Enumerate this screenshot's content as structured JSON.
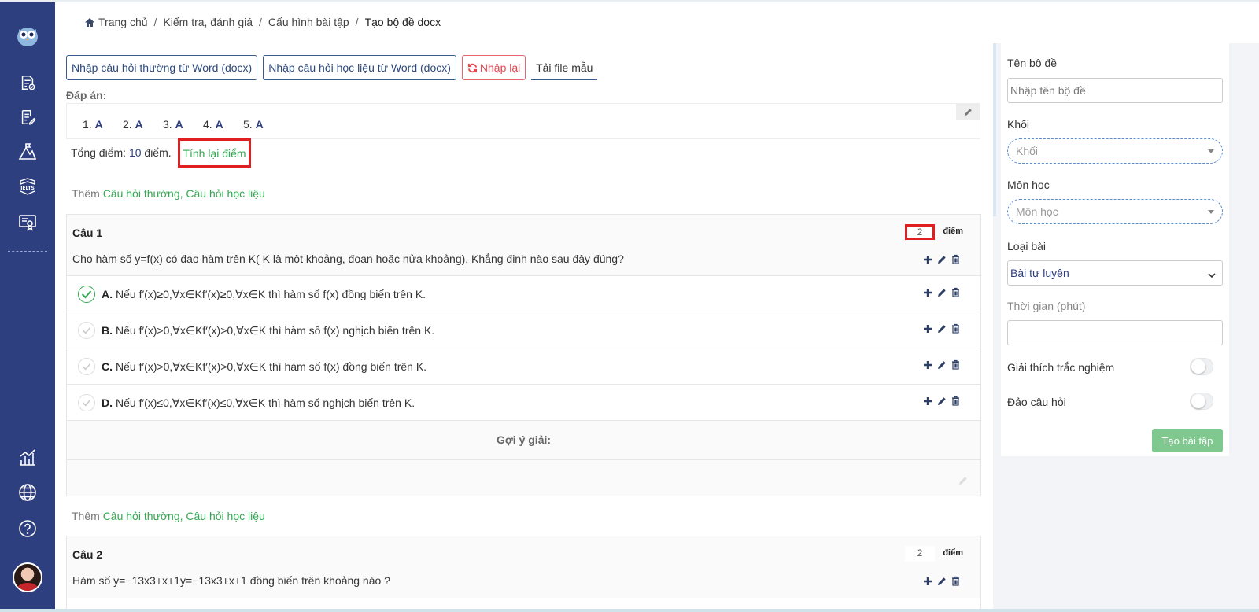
{
  "breadcrumb": {
    "home": "Trang chủ",
    "sep": "/",
    "level1": "Kiểm tra, đánh giá",
    "level2": "Cấu hình bài tập",
    "current": "Tạo bộ đề docx"
  },
  "toolbar": {
    "import_normal": "Nhập câu hỏi thường từ Word (docx)",
    "import_material": "Nhập câu hỏi học liệu từ Word (docx)",
    "reimport": "Nhập lại",
    "download_template": "Tải file mẫu"
  },
  "answers": {
    "label": "Đáp án:",
    "items": [
      {
        "num": "1.",
        "letter": "A"
      },
      {
        "num": "2.",
        "letter": "A"
      },
      {
        "num": "3.",
        "letter": "A"
      },
      {
        "num": "4.",
        "letter": "A"
      },
      {
        "num": "5.",
        "letter": "A"
      }
    ]
  },
  "total": {
    "prefix": "Tổng điểm:",
    "points": "10",
    "suffix": "điểm.",
    "recalc": "Tính lại điểm"
  },
  "add_line": {
    "prefix": "Thêm",
    "links": "Câu hỏi thường, Câu hỏi học liệu"
  },
  "questions": [
    {
      "title": "Câu 1",
      "score": "2",
      "score_label": "điểm",
      "text": "Cho hàm số y=f(x) có đạo hàm trên K( K là một khoảng, đoạn hoặc nửa khoảng). Khẳng định nào sau đây đúng?",
      "options": [
        {
          "letter": "A.",
          "text": "Nếu f′(x)≥0,∀x∈Kf′(x)≥0,∀x∈K thì hàm số f(x) đồng biến trên K.",
          "correct": true
        },
        {
          "letter": "B.",
          "text": "Nếu f′(x)>0,∀x∈Kf′(x)>0,∀x∈K thì hàm số f(x) nghịch biến trên K.",
          "correct": false
        },
        {
          "letter": "C.",
          "text": "Nếu f′(x)>0,∀x∈Kf′(x)>0,∀x∈K thì hàm số f(x) đồng biến trên K.",
          "correct": false
        },
        {
          "letter": "D.",
          "text": "Nếu f′(x)≤0,∀x∈Kf′(x)≤0,∀x∈K thì hàm số nghịch biến trên K.",
          "correct": false
        }
      ],
      "hint_label": "Gợi ý giải:"
    },
    {
      "title": "Câu 2",
      "score": "2",
      "score_label": "điểm",
      "text": "Hàm số y=−13x3+x+1y=−13x3+x+1 đồng biến trên khoảng nào ?"
    }
  ],
  "form": {
    "name_label": "Tên bộ đề",
    "name_placeholder": "Nhập tên bộ đề",
    "grade_label": "Khối",
    "grade_placeholder": "Khối",
    "subject_label": "Môn học",
    "subject_placeholder": "Môn học",
    "type_label": "Loại bài",
    "type_value": "Bài tự luyện",
    "time_label": "Thời gian (phút)",
    "explain_label": "Giải thích trắc nghiệm",
    "shuffle_label": "Đảo câu hỏi",
    "submit": "Tạo bài tập"
  },
  "colors": {
    "sidebar": "#2e3f80",
    "green": "#33a852",
    "highlight_red": "#e02020",
    "primary_blue": "#2e3f80",
    "submit_green": "#7fc98f"
  },
  "icons": {
    "sidebar": [
      "owl-logo-icon",
      "document-check-icon",
      "document-edit-icon",
      "chart-mountain-icon",
      "ielts-badge-icon",
      "certificate-icon",
      "bar-chart-icon",
      "globe-icon",
      "question-circle-icon"
    ],
    "row_actions": [
      "plus-icon",
      "pencil-icon",
      "trash-icon"
    ]
  }
}
